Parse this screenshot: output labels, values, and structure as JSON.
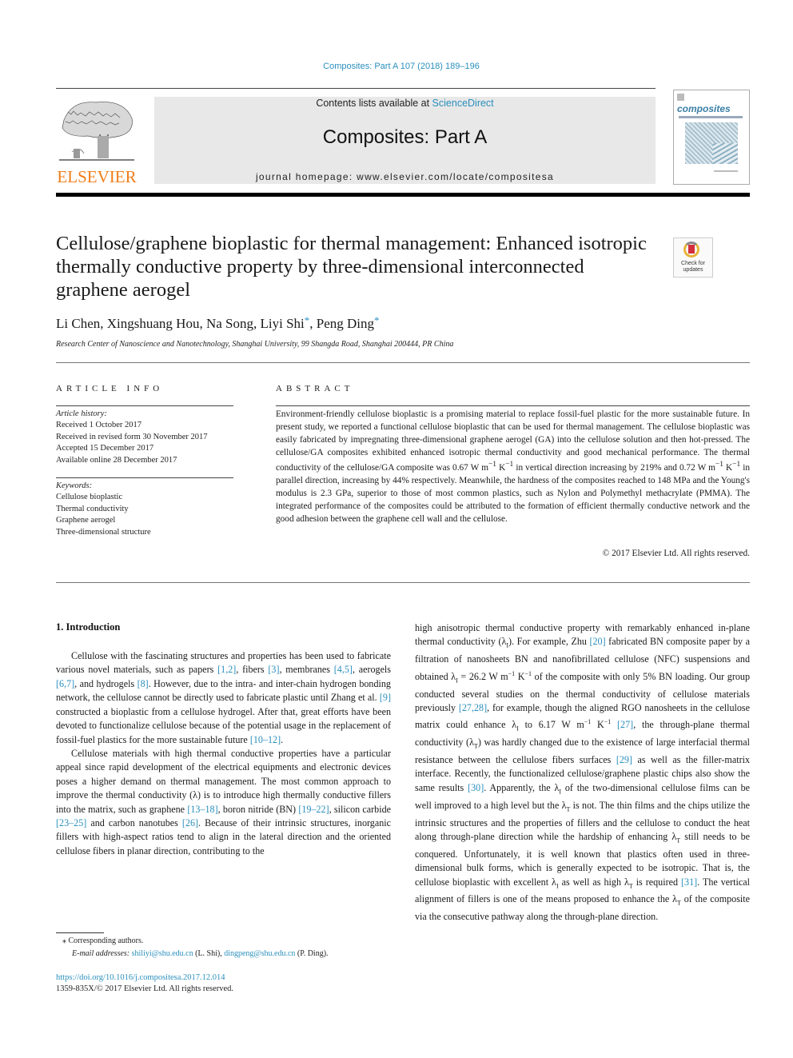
{
  "header": {
    "journal_ref": "Composites: Part A 107 (2018) 189–196",
    "contents_prefix": "Contents lists available at ",
    "contents_link": "ScienceDirect",
    "journal_name": "Composites: Part A",
    "homepage_prefix": "journal homepage: ",
    "homepage_url": "www.elsevier.com/locate/compositesa",
    "publisher_logo_text": "ELSEVIER",
    "cover_title": "composites",
    "crossmark_label": "Check for updates",
    "colors": {
      "link": "#2a8fbd",
      "elsevier_orange": "#f07d1a",
      "banner_bg": "#e8e8e8"
    }
  },
  "article": {
    "title": "Cellulose/graphene bioplastic for thermal management: Enhanced isotropic thermally conductive property by three-dimensional interconnected graphene aerogel",
    "authors": [
      {
        "name": "Li Chen",
        "corresponding": false
      },
      {
        "name": "Xingshuang Hou",
        "corresponding": false
      },
      {
        "name": "Na Song",
        "corresponding": false
      },
      {
        "name": "Liyi Shi",
        "corresponding": true
      },
      {
        "name": "Peng Ding",
        "corresponding": true
      }
    ],
    "affiliation": "Research Center of Nanoscience and Nanotechnology, Shanghai University, 99 Shangda Road, Shanghai 200444, PR China"
  },
  "article_info": {
    "heading": "ARTICLE INFO",
    "history_label": "Article history:",
    "history": [
      "Received 1 October 2017",
      "Received in revised form 30 November 2017",
      "Accepted 15 December 2017",
      "Available online 28 December 2017"
    ],
    "keywords_label": "Keywords:",
    "keywords": [
      "Cellulose bioplastic",
      "Thermal conductivity",
      "Graphene aerogel",
      "Three-dimensional structure"
    ]
  },
  "abstract": {
    "heading": "ABSTRACT",
    "text_1": "Environment-friendly cellulose bioplastic is a promising material to replace fossil-fuel plastic for the more sustainable future. In present study, we reported a functional cellulose bioplastic that can be used for thermal management. The cellulose bioplastic was easily fabricated by impregnating three-dimensional graphene aerogel (GA) into the cellulose solution and then hot-pressed. The cellulose/GA composites exhibited enhanced isotropic thermal conductivity and good mechanical performance. The thermal conductivity of the cellulose/GA composite was 0.67 W m",
    "text_2": " in vertical direction increasing by 219% and 0.72 W m",
    "text_3": " in parallel direction, increasing by 44% respectively. Meanwhile, the hardness of the composites reached to 148 MPa and the Young's modulus is 2.3 GPa, superior to those of most common plastics, such as Nylon and Polymethyl methacrylate (PMMA). The integrated performance of the composites could be attributed to the formation of efficient thermally conductive network and the good adhesion between the graphene cell wall and the cellulose.",
    "unit_sup": "−1",
    "unit_K": " K",
    "copyright": "© 2017 Elsevier Ltd. All rights reserved."
  },
  "introduction": {
    "heading": "1. Introduction",
    "p1": [
      {
        "t": "Cellulose with the fascinating structures and properties has been used to fabricate various novel materials, such as papers "
      },
      {
        "ref": "[1,2]"
      },
      {
        "t": ", fibers "
      },
      {
        "ref": "[3]"
      },
      {
        "t": ", membranes "
      },
      {
        "ref": "[4,5]"
      },
      {
        "t": ", aerogels "
      },
      {
        "ref": "[6,7]"
      },
      {
        "t": ", and hydrogels "
      },
      {
        "ref": "[8]"
      },
      {
        "t": ". However, due to the intra- and inter-chain hydrogen bonding network, the cellulose cannot be directly used to fabricate plastic until Zhang et al. "
      },
      {
        "ref": "[9]"
      },
      {
        "t": " constructed a bioplastic from a cellulose hydrogel. After that, great efforts have been devoted to functionalize cellulose because of the potential usage in the replacement of fossil-fuel plastics for the more sustainable future "
      },
      {
        "ref": "[10–12]"
      },
      {
        "t": "."
      }
    ],
    "p2": [
      {
        "t": "Cellulose materials with high thermal conductive properties have a particular appeal since rapid development of the electrical equipments and electronic devices poses a higher demand on thermal management. The most common approach to improve the thermal conductivity (λ) is to introduce high thermally conductive fillers into the matrix, such as graphene "
      },
      {
        "ref": "[13–18]"
      },
      {
        "t": ", boron nitride (BN) "
      },
      {
        "ref": "[19–22]"
      },
      {
        "t": ", silicon carbide "
      },
      {
        "ref": "[23–25]"
      },
      {
        "t": " and carbon nanotubes "
      },
      {
        "ref": "[26]"
      },
      {
        "t": ". Because of their intrinsic structures, inorganic fillers with high-aspect ratios tend to align in the lateral direction and the oriented cellulose fibers in planar direction, contributing to the"
      }
    ],
    "p2_cont": [
      {
        "t": "high anisotropic thermal conductive property with remarkably enhanced in-plane thermal conductivity (λ"
      },
      {
        "sub": "I"
      },
      {
        "t": "). For example, Zhu "
      },
      {
        "ref": "[20]"
      },
      {
        "t": " fabricated BN composite paper by a filtration of nanosheets BN and nanofibrillated cellulose (NFC) suspensions and obtained λ"
      },
      {
        "sub": "I"
      },
      {
        "t": " = 26.2 W m"
      },
      {
        "sup": "−1"
      },
      {
        "t": " K"
      },
      {
        "sup": "−1"
      },
      {
        "t": " of the composite with only 5% BN loading. Our group conducted several studies on the thermal conductivity of cellulose materials previously "
      },
      {
        "ref": "[27,28]"
      },
      {
        "t": ", for example, though the aligned RGO nanosheets in the cellulose matrix could enhance λ"
      },
      {
        "sub": "I"
      },
      {
        "t": " to 6.17 W m"
      },
      {
        "sup": "−1"
      },
      {
        "t": " K"
      },
      {
        "sup": "−1"
      },
      {
        "t": " "
      },
      {
        "ref": "[27]"
      },
      {
        "t": ", the through-plane thermal conductivity (λ"
      },
      {
        "sub": "T"
      },
      {
        "t": ") was hardly changed due to the existence of large interfacial thermal resistance between the cellulose fibers surfaces "
      },
      {
        "ref": "[29]"
      },
      {
        "t": " as well as the filler-matrix interface. Recently, the functionalized cellulose/graphene plastic chips also show the same results "
      },
      {
        "ref": "[30]"
      },
      {
        "t": ". Apparently, the λ"
      },
      {
        "sub": "I"
      },
      {
        "t": " of the two-dimensional cellulose films can be well improved to a high level but the λ"
      },
      {
        "sub": "T"
      },
      {
        "t": " is not. The thin films and the chips utilize the intrinsic structures and the properties of fillers and the cellulose to conduct the heat along through-plane direction while the hardship of enhancing λ"
      },
      {
        "sub": "T"
      },
      {
        "t": " still needs to be conquered. Unfortunately, it is well known that plastics often used in three-dimensional bulk forms, which is generally expected to be isotropic. That is, the cellulose bioplastic with excellent λ"
      },
      {
        "sub": "I"
      },
      {
        "t": " as well as high λ"
      },
      {
        "sub": "T"
      },
      {
        "t": " is required "
      },
      {
        "ref": "[31]"
      },
      {
        "t": ". The vertical alignment of fillers is one of the means proposed to enhance the λ"
      },
      {
        "sub": "T"
      },
      {
        "t": " of the composite via the consecutive pathway along the through-plane direction."
      }
    ]
  },
  "footnotes": {
    "corresponding": "⁎ Corresponding authors.",
    "email_label": "E-mail addresses:",
    "email_1": "shiliyi@shu.edu.cn",
    "email_1_owner": " (L. Shi), ",
    "email_2": "dingpeng@shu.edu.cn",
    "email_2_owner": " (P. Ding).",
    "doi": "https://doi.org/10.1016/j.compositesa.2017.12.014",
    "issn": "1359-835X/© 2017 Elsevier Ltd. All rights reserved."
  }
}
